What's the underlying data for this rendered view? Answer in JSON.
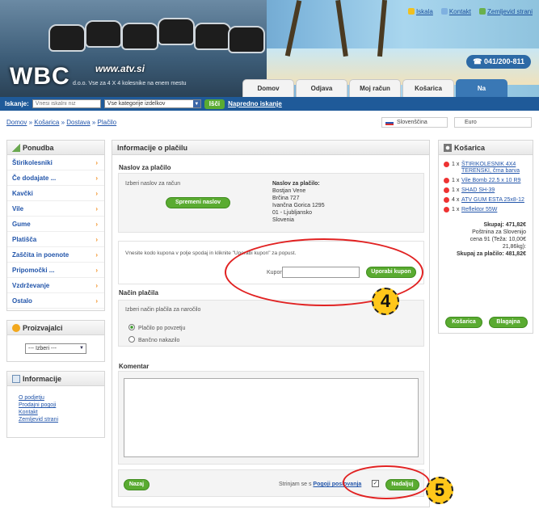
{
  "header": {
    "logo": "WBC",
    "url": "www.atv.si",
    "tagline": "d.o.o.  Vse za 4 X 4 kolesnike na enem mestu",
    "toplinks": [
      "Iskala",
      "Kontakt",
      "Zemljevid strani"
    ],
    "phone": "041/200-811",
    "tabs": [
      "Domov",
      "Odjava",
      "Moj račun",
      "Košarica",
      "Na blagajno"
    ]
  },
  "search": {
    "label": "Iskanje:",
    "placeholder": "Vnesi iskalni niz",
    "category": "Vse kategorije izdelkov",
    "button": "Išči",
    "advanced": "Napredno iskanje"
  },
  "breadcrumb": [
    "Domov",
    "Košarica",
    "Dostava",
    "Plačilo"
  ],
  "language": "Slovenščina",
  "currency": "Euro",
  "sidebar": {
    "cat_title": "Ponudba",
    "categories": [
      "Štirikolesniki",
      "Če dodajate ... ",
      "Kavčki",
      "Vile",
      "Gume",
      "Platišča",
      "Zaščita in poenote",
      "Pripomočki ...",
      "Vzdrževanje",
      "Ostalo"
    ],
    "maker_title": "Proizvajalci",
    "maker_value": "--- Izberi ---",
    "info_title": "Informacije",
    "info_links": [
      "O podjetju",
      "Prodajni pogoji",
      "Kontakt",
      "Zemljevid strani"
    ]
  },
  "main": {
    "title": "Informacije o plačilu",
    "addr_section": "Naslov za plačilo",
    "addr_hint": "Izberi naslov za račun",
    "change_addr": "Spremeni naslov",
    "addr_label": "Naslov za plačilo:",
    "addr_lines": [
      "Bostjan Vene",
      "Brčina 727",
      "Ivančna Gorica 1295",
      "01 - Ljubljansko",
      "Slovenia"
    ],
    "coupon_text": "Vnesite kodo kupona v polje spodaj in kliknite \"Uporabi kupon\" za popust.",
    "coupon_label": "Kupon:",
    "coupon_btn": "Uporabi kupon",
    "pay_section": "Način plačila",
    "pay_hint": "Izberi način plačila za naročilo",
    "pay_options": [
      "Plačilo po povzetju",
      "Bančno nakazilo"
    ],
    "comment_section": "Komentar",
    "back_btn": "Nazaj",
    "agree_text": "Strinjam se s",
    "agree_link": "Pogoji poslovanja",
    "next_btn": "Nadaljuj"
  },
  "cart": {
    "title": "Košarica",
    "items": [
      {
        "qty": "1 x",
        "name": "ŠTIRIKOLESNIK 4X4 TERENSKI, črna barva"
      },
      {
        "qty": "1 x",
        "name": "Vile Bomb 22.5 x 10 R9"
      },
      {
        "qty": "1 x",
        "name": "SHAD SH-39"
      },
      {
        "qty": "4 x",
        "name": "ATV GUM ESTA 25x8-12"
      },
      {
        "qty": "1 x",
        "name": "Reflektor 55W"
      }
    ],
    "subtotal": "Skupaj: 471,82€",
    "shipping": "Poštnina za Slovenijo",
    "shipping_note": "cena 91 (Teža: 10,00€",
    "weight": "21,86kg):",
    "total": "Skupaj za plačilo: 481,82€",
    "cart_btn": "Košarica",
    "checkout_btn": "Blagajna"
  },
  "badges": [
    "4",
    "5"
  ]
}
